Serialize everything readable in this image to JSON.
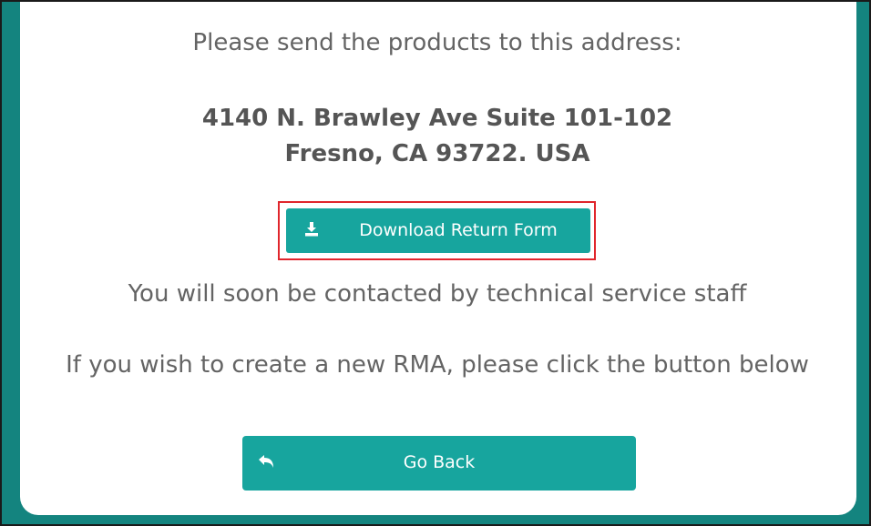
{
  "instructions": "Please send the products to this address:",
  "address": {
    "line1": "4140 N. Brawley Ave Suite 101-102",
    "line2": "Fresno, CA 93722. USA"
  },
  "download_button": {
    "label": "Download Return Form",
    "icon": "download-icon"
  },
  "contact_message": "You will soon be contacted by technical service staff",
  "create_rma_message": "If you wish to create a new RMA, please click the button below",
  "back_button": {
    "label": "Go Back",
    "icon": "reply-arrow-icon"
  },
  "colors": {
    "accent": "#17a59e",
    "frame": "#14847f",
    "text": "#646464",
    "highlight": "#e0262c"
  }
}
